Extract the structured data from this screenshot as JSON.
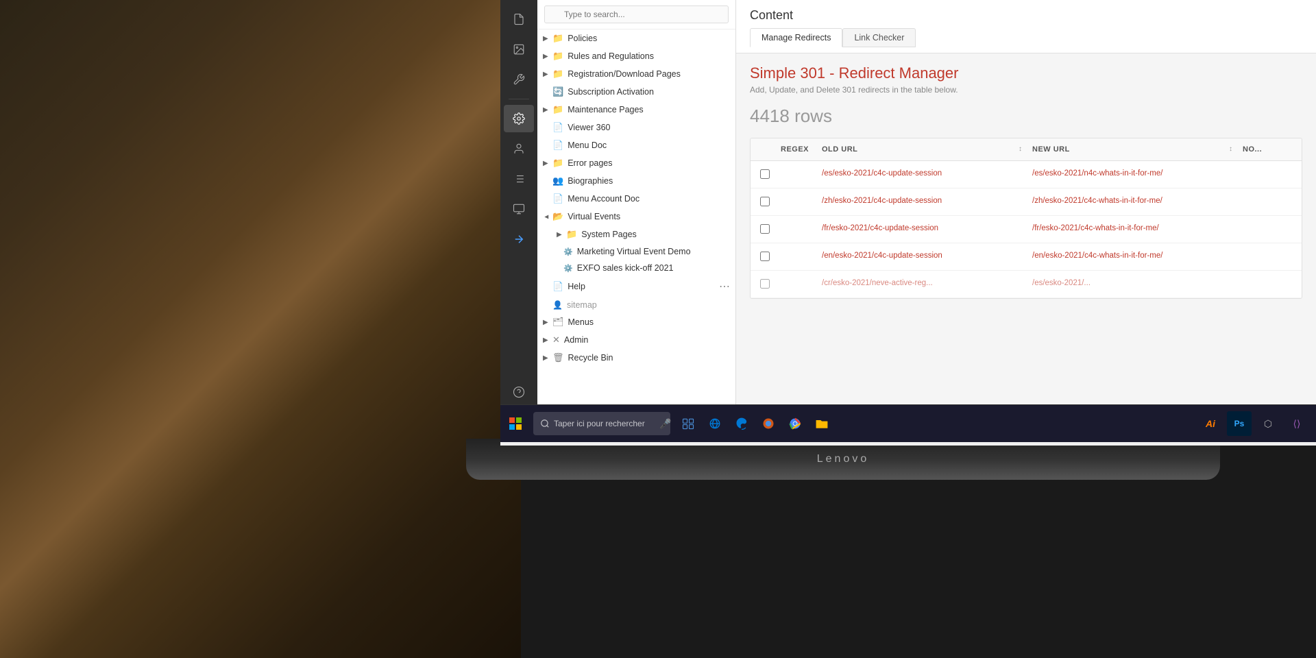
{
  "background": {
    "description": "Person using laptop, blurred background"
  },
  "cms": {
    "icon_sidebar": {
      "items": [
        {
          "name": "document-icon",
          "symbol": "📄"
        },
        {
          "name": "image-icon",
          "symbol": "🖼"
        },
        {
          "name": "wrench-icon",
          "symbol": "🔧"
        },
        {
          "name": "gear-icon",
          "symbol": "⚙"
        },
        {
          "name": "person-icon",
          "symbol": "👤"
        },
        {
          "name": "list-icon",
          "symbol": "≡"
        },
        {
          "name": "monitor-icon",
          "symbol": "🖥"
        },
        {
          "name": "arrow-icon",
          "symbol": "→"
        },
        {
          "name": "help-icon",
          "symbol": "?"
        }
      ]
    },
    "search": {
      "placeholder": "Type to search..."
    },
    "tree": {
      "items": [
        {
          "id": "policies",
          "label": "Policies",
          "level": 0,
          "type": "folder",
          "arrow": "▶"
        },
        {
          "id": "rules",
          "label": "Rules and Regulations",
          "level": 0,
          "type": "folder",
          "arrow": "▶"
        },
        {
          "id": "registration",
          "label": "Registration/Download Pages",
          "level": 0,
          "type": "folder",
          "arrow": "▶"
        },
        {
          "id": "subscription",
          "label": "Subscription Activation",
          "level": 0,
          "type": "settings",
          "arrow": ""
        },
        {
          "id": "maintenance",
          "label": "Maintenance Pages",
          "level": 0,
          "type": "folder",
          "arrow": "▶"
        },
        {
          "id": "viewer360",
          "label": "Viewer 360",
          "level": 0,
          "type": "page",
          "arrow": ""
        },
        {
          "id": "menudoc",
          "label": "Menu Doc",
          "level": 0,
          "type": "page",
          "arrow": ""
        },
        {
          "id": "error",
          "label": "Error pages",
          "level": 0,
          "type": "folder",
          "arrow": "▶"
        },
        {
          "id": "biographies",
          "label": "Biographies",
          "level": 0,
          "type": "people",
          "arrow": ""
        },
        {
          "id": "menuaccount",
          "label": "Menu Account Doc",
          "level": 0,
          "type": "page",
          "arrow": ""
        },
        {
          "id": "virtualevents",
          "label": "Virtual Events",
          "level": 0,
          "type": "folder-open",
          "arrow": "▼"
        },
        {
          "id": "systempages",
          "label": "System Pages",
          "level": 1,
          "type": "folder",
          "arrow": "▶"
        },
        {
          "id": "marketing",
          "label": "Marketing Virtual Event Demo",
          "level": 1,
          "type": "settings2",
          "arrow": ""
        },
        {
          "id": "exfo",
          "label": "EXFO sales kick-off 2021",
          "level": 1,
          "type": "settings2",
          "arrow": ""
        },
        {
          "id": "help",
          "label": "Help",
          "level": 0,
          "type": "page",
          "arrow": ""
        },
        {
          "id": "sitemap",
          "label": "sitemap",
          "level": 0,
          "type": "person-small",
          "arrow": ""
        },
        {
          "id": "menus",
          "label": "Menus",
          "level": 0,
          "type": "sitemap",
          "arrow": "▶"
        },
        {
          "id": "admin",
          "label": "Admin",
          "level": 0,
          "type": "x",
          "arrow": "▶"
        },
        {
          "id": "recycle",
          "label": "Recycle Bin",
          "level": 0,
          "type": "trash",
          "arrow": "▶"
        }
      ]
    }
  },
  "content": {
    "title": "Content",
    "tabs": [
      {
        "id": "manage-redirects",
        "label": "Manage Redirects",
        "active": true
      },
      {
        "id": "link-checker",
        "label": "Link Checker",
        "active": false
      }
    ],
    "redirect_manager": {
      "title": "Simple 301 - Redirect Manager",
      "subtitle": "Add, Update, and Delete 301 redirects in the table below.",
      "rows_count": "4418 rows"
    },
    "table": {
      "columns": [
        {
          "id": "checkbox",
          "label": ""
        },
        {
          "id": "regex",
          "label": "REGEX"
        },
        {
          "id": "old_url",
          "label": "OLD URL"
        },
        {
          "id": "sort",
          "label": "↕"
        },
        {
          "id": "new_url",
          "label": "NEW URL"
        },
        {
          "id": "sort2",
          "label": "↕"
        },
        {
          "id": "notes",
          "label": "NO..."
        }
      ],
      "rows": [
        {
          "old_url": "/es/esko-2021/c4c-update-session",
          "new_url": "/es/esko-2021/n4c-whats-in-it-for-me/"
        },
        {
          "old_url": "/zh/esko-2021/c4c-update-session",
          "new_url": "/zh/esko-2021/c4c-whats-in-it-for-me/"
        },
        {
          "old_url": "/fr/esko-2021/c4c-update-session",
          "new_url": "/fr/esko-2021/c4c-whats-in-it-for-me/"
        },
        {
          "old_url": "/en/esko-2021/c4c-update-session",
          "new_url": "/en/esko-2021/c4c-whats-in-it-for-me/"
        },
        {
          "old_url": "/cr/esko-2021/neve-active-reg...",
          "new_url": "/es/esko-2021/..."
        }
      ]
    }
  },
  "taskbar": {
    "search_placeholder": "Taper ici pour rechercher",
    "mic_symbol": "🎤",
    "apps": [
      "IE",
      "Edge",
      "Firefox",
      "Chrome",
      "Explorer",
      "PS",
      "AI",
      "VS"
    ]
  },
  "laptop": {
    "brand": "Lenovo"
  }
}
